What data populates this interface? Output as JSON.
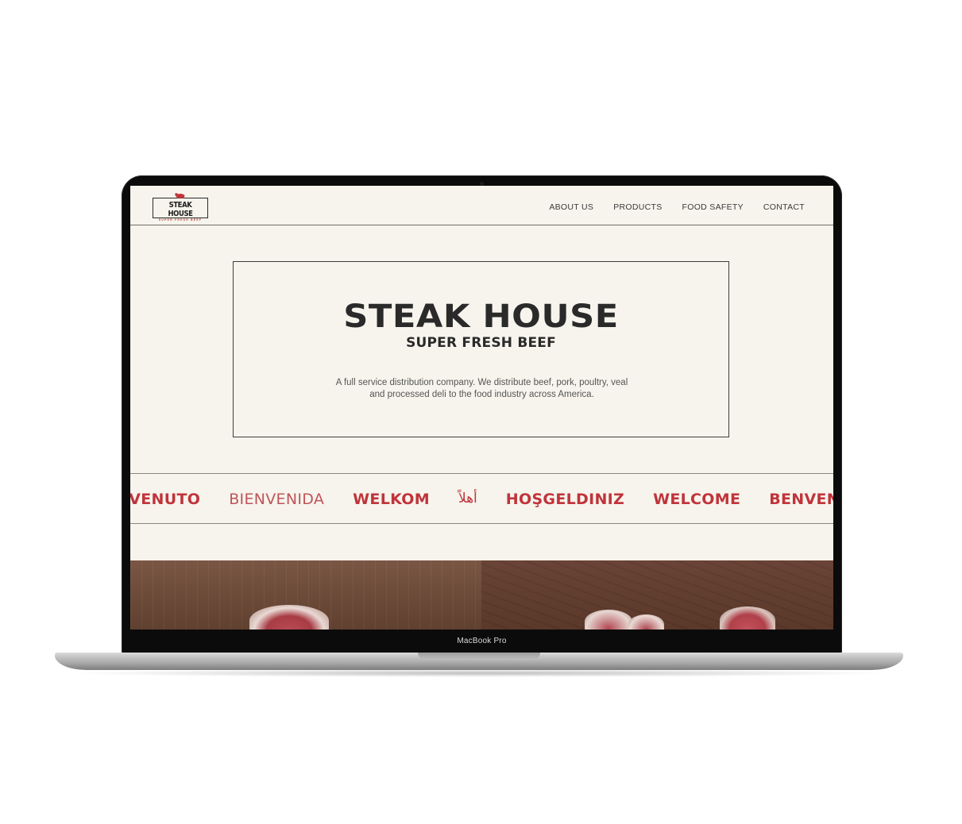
{
  "device": {
    "label": "MacBook Pro"
  },
  "site": {
    "logo": {
      "name": "STEAK HOUSE",
      "tagline": "SUPER FRESH BEEF"
    },
    "nav": {
      "items": [
        {
          "label": "ABOUT US"
        },
        {
          "label": "PRODUCTS"
        },
        {
          "label": "FOOD SAFETY"
        },
        {
          "label": "CONTACT"
        }
      ]
    },
    "hero": {
      "title": "STEAK HOUSE",
      "subtitle": "SUPER FRESH BEEF",
      "description": "A full service distribution company. We distribute beef, pork, poultry, veal and processed deli to the food industry across America."
    },
    "marquee": {
      "words": [
        "BENVENUTO",
        "BIENVENIDA",
        "WELKOM",
        "أهلاً",
        "HOŞGELDINIZ",
        "WELCOME",
        "BENVENUTO"
      ]
    }
  },
  "colors": {
    "page_bg": "#f6f4ec",
    "accent_red": "#c0343b",
    "text_dark": "#2a2a2a"
  }
}
